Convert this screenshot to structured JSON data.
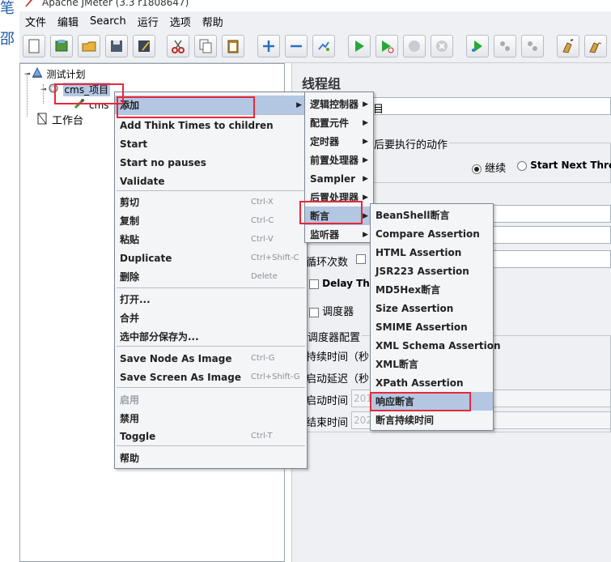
{
  "window": {
    "title": "Apache JMeter (3.3 r1808647)"
  },
  "edge_glyphs": [
    "笔",
    "邵"
  ],
  "menubar": [
    "文件",
    "编辑",
    "Search",
    "运行",
    "选项",
    "帮助"
  ],
  "toolbar": [
    "new-icon",
    "templates-icon",
    "open-icon",
    "save-icon",
    "save-as-icon",
    "cut-icon",
    "copy-icon",
    "paste-icon",
    "expand-icon",
    "collapse-icon",
    "toggle-icon",
    "start-icon",
    "start-no-pauses-icon",
    "stop-icon",
    "shutdown-icon",
    "remote-start-icon",
    "remote-stop-icon",
    "remote-shutdown-icon",
    "clear-icon",
    "clear-all-icon"
  ],
  "tree": {
    "test_plan": "测试计划",
    "thread_group": "cms_项目",
    "child": "cms",
    "workbench": "工作台"
  },
  "right_panel": {
    "title": "线程组",
    "name_suffix": "目",
    "action_label": "后要执行的动作",
    "continue_label": "继续",
    "next_thread_label": "Start Next Thread",
    "loop_label": "循环次数",
    "delay_label": "Delay Thre",
    "scheduler_label": "调度器",
    "scheduler_config": "调度器配置",
    "duration_label": "持续时间（秒",
    "startup_delay_label": "启动延迟（秒",
    "start_time_label": "启动时间",
    "end_time_label": "结束时间",
    "start_time_value": "201",
    "end_time_value": "202"
  },
  "context_menu": {
    "items": [
      {
        "label": "添加",
        "submenu": true
      },
      {
        "label": "Add Think Times to children"
      },
      {
        "label": "Start"
      },
      {
        "label": "Start no pauses"
      },
      {
        "label": "Validate"
      },
      {
        "label": "剪切",
        "shortcut": "Ctrl-X"
      },
      {
        "label": "复制",
        "shortcut": "Ctrl-C"
      },
      {
        "label": "粘贴",
        "shortcut": "Ctrl-V"
      },
      {
        "label": "Duplicate",
        "shortcut": "Ctrl+Shift-C"
      },
      {
        "label": "删除",
        "shortcut": "Delete"
      },
      {
        "label": "打开..."
      },
      {
        "label": "合并"
      },
      {
        "label": "选中部分保存为..."
      },
      {
        "label": "Save Node As Image",
        "shortcut": "Ctrl-G"
      },
      {
        "label": "Save Screen As Image",
        "shortcut": "Ctrl+Shift-G"
      },
      {
        "label": "启用",
        "disabled": true
      },
      {
        "label": "禁用"
      },
      {
        "label": "Toggle",
        "shortcut": "Ctrl-T"
      },
      {
        "label": "帮助"
      }
    ]
  },
  "add_submenu": {
    "items": [
      "逻辑控制器",
      "配置元件",
      "定时器",
      "前置处理器",
      "Sampler",
      "后置处理器",
      "断言",
      "监听器"
    ]
  },
  "assertion_submenu": {
    "items": [
      "BeanShell断言",
      "Compare Assertion",
      "HTML Assertion",
      "JSR223 Assertion",
      "MD5Hex断言",
      "Size Assertion",
      "SMIME Assertion",
      "XML Schema Assertion",
      "XML断言",
      "XPath Assertion",
      "响应断言",
      "断言持续时间"
    ]
  },
  "colors": {
    "highlight": "#b3c7e3",
    "annotation_red": "#e8283a",
    "menu_bg": "#f4f5f7"
  }
}
